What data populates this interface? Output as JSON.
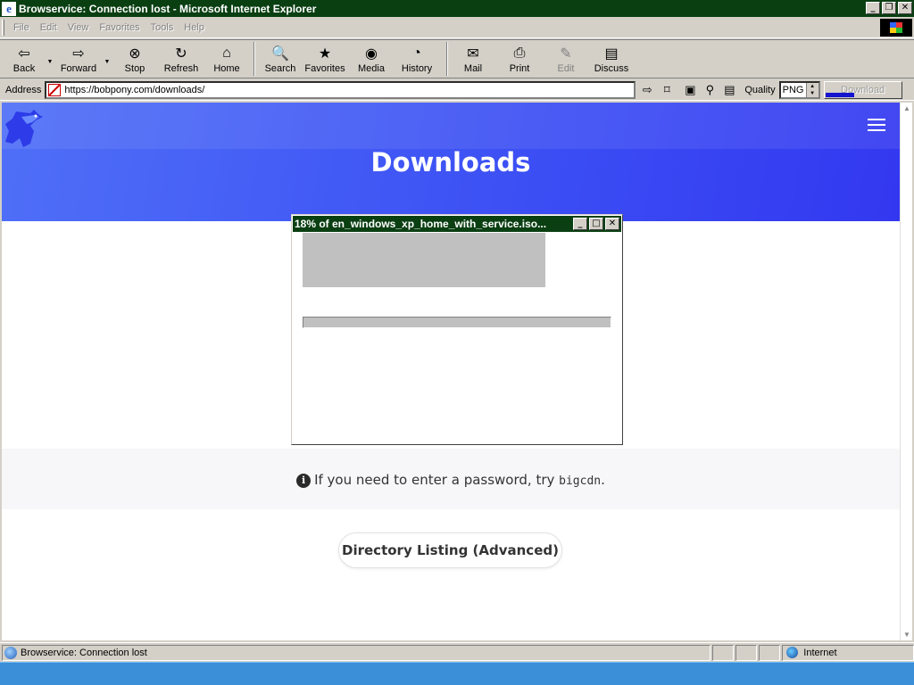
{
  "window": {
    "title": "Browservice: Connection lost - Microsoft Internet Explorer",
    "minimize_glyph": "_",
    "maximize_glyph": "❐",
    "close_glyph": "✕"
  },
  "menu": [
    {
      "label": "File"
    },
    {
      "label": "Edit"
    },
    {
      "label": "View"
    },
    {
      "label": "Favorites"
    },
    {
      "label": "Tools"
    },
    {
      "label": "Help"
    }
  ],
  "toolbar": {
    "back": {
      "label": "Back",
      "icon": "back-arrow-icon",
      "glyph": "⇦"
    },
    "forward": {
      "label": "Forward",
      "icon": "forward-arrow-icon",
      "glyph": "⇨"
    },
    "stop": {
      "label": "Stop",
      "icon": "stop-icon",
      "glyph": "⊗"
    },
    "refresh": {
      "label": "Refresh",
      "icon": "refresh-icon",
      "glyph": "↻"
    },
    "home": {
      "label": "Home",
      "icon": "home-icon",
      "glyph": "⌂"
    },
    "search": {
      "label": "Search",
      "icon": "search-icon",
      "glyph": "🔍"
    },
    "favorites": {
      "label": "Favorites",
      "icon": "favorites-icon",
      "glyph": "★"
    },
    "media": {
      "label": "Media",
      "icon": "media-icon",
      "glyph": "◉"
    },
    "history": {
      "label": "History",
      "icon": "history-icon",
      "glyph": "◔"
    },
    "mail": {
      "label": "Mail",
      "icon": "mail-icon",
      "glyph": "✉"
    },
    "print": {
      "label": "Print",
      "icon": "print-icon",
      "glyph": "⎙"
    },
    "edit": {
      "label": "Edit",
      "icon": "edit-icon",
      "glyph": "✎"
    },
    "discuss": {
      "label": "Discuss",
      "icon": "discuss-icon",
      "glyph": "▤"
    }
  },
  "address": {
    "label": "Address",
    "url": "https://bobpony.com/downloads/",
    "quality_label": "Quality",
    "quality_value": "PNG",
    "download_label": "Download",
    "download_progress": 0.38
  },
  "page": {
    "heading": "Downloads",
    "info_text": "If you need to enter a password, try ",
    "info_code": "bigcdn",
    "info_end": ".",
    "info_icon_glyph": "i",
    "dir_button": "Directory Listing (Advanced)",
    "accent_color": "#3b4ef4"
  },
  "dialog": {
    "title": "18% of en_windows_xp_home_with_service.iso...",
    "progress": 0.18
  },
  "statusbar": {
    "text": "Browservice: Connection lost",
    "zone": "Internet"
  }
}
